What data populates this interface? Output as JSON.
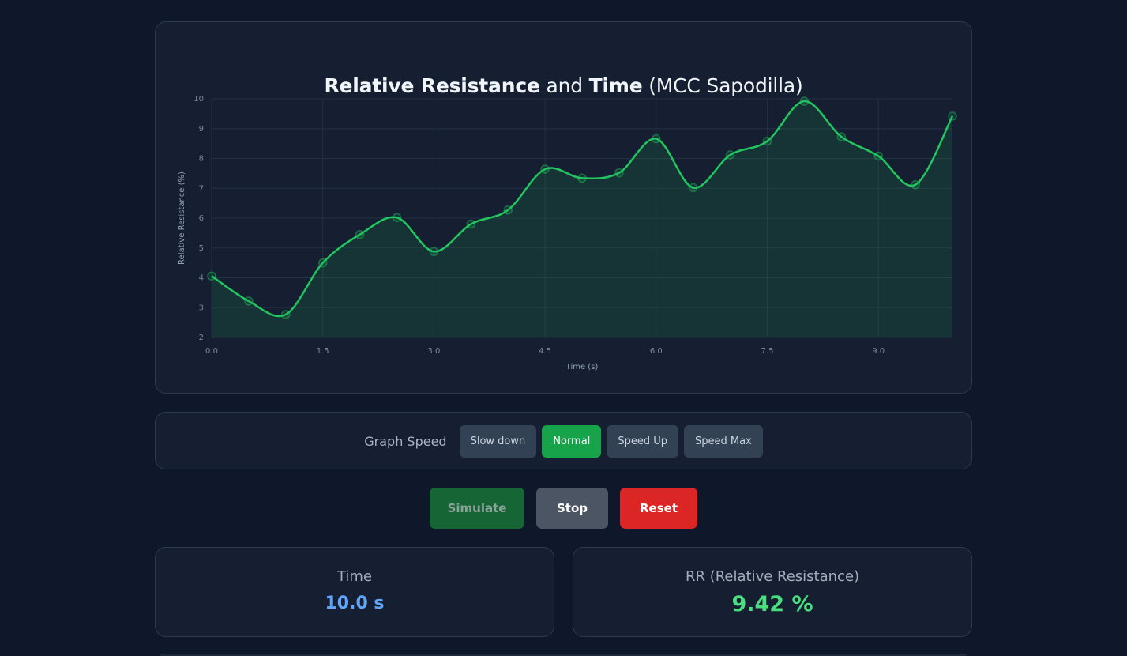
{
  "chart": {
    "title_bold1": "Relative Resistance",
    "title_and": " and ",
    "title_bold2": "Time",
    "title_rest": " (MCC Sapodilla)"
  },
  "chart_data": {
    "type": "line",
    "xlabel": "Time (s)",
    "ylabel": "Relative Resistance (%)",
    "xlim": [
      0,
      10
    ],
    "ylim": [
      2,
      10
    ],
    "xticks": [
      "0.0",
      "1.5",
      "3.0",
      "4.5",
      "6.0",
      "7.5",
      "9.0"
    ],
    "yticks": [
      "2",
      "3",
      "4",
      "5",
      "6",
      "7",
      "8",
      "9",
      "10"
    ],
    "grid": true,
    "series": [
      {
        "color": "#22c55e",
        "x": [
          0,
          0.5,
          1.0,
          1.5,
          2.0,
          2.5,
          3.0,
          3.5,
          4.0,
          4.5,
          5.0,
          5.5,
          6.0,
          6.5,
          7.0,
          7.5,
          8.0,
          8.5,
          9.0,
          9.5,
          10.0
        ],
        "y": [
          4.06,
          3.22,
          2.77,
          4.5,
          5.45,
          6.02,
          4.88,
          5.8,
          6.27,
          7.64,
          7.34,
          7.52,
          8.66,
          7.02,
          8.12,
          8.58,
          9.92,
          8.73,
          8.08,
          7.12,
          9.42
        ]
      }
    ]
  },
  "speed": {
    "label": "Graph Speed",
    "buttons": [
      "Slow down",
      "Normal",
      "Speed Up",
      "Speed Max"
    ],
    "active": "Normal"
  },
  "actions": {
    "simulate": "Simulate",
    "stop": "Stop",
    "reset": "Reset"
  },
  "stats": {
    "time_label": "Time",
    "time_value": "10.0 s",
    "rr_label": "RR (Relative Resistance)",
    "rr_value": "9.42 %"
  }
}
